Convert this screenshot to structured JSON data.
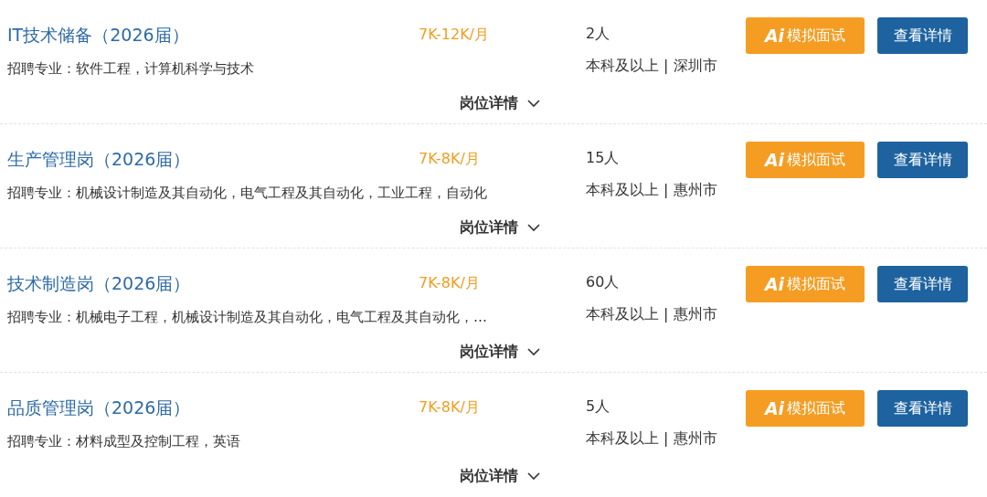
{
  "jobs": [
    {
      "title": "IT技术储备（2026届）",
      "salary": "7K-12K/月",
      "headcount": "2人",
      "majors": "招聘专业：软件工程，计算机科学与技术",
      "requirement": "本科及以上 | 深圳市",
      "ai_button": {
        "logo": "Ai",
        "label": "模拟面试"
      },
      "detail_button": "查看详情",
      "toggle": "岗位详情",
      "expanded": false
    },
    {
      "title": "生产管理岗（2026届）",
      "salary": "7K-8K/月",
      "headcount": "15人",
      "majors": "招聘专业：机械设计制造及其自动化，电气工程及其自动化，工业工程，自动化",
      "requirement": "本科及以上 | 惠州市",
      "ai_button": {
        "logo": "Ai",
        "label": "模拟面试"
      },
      "detail_button": "查看详情",
      "toggle": "岗位详情",
      "expanded": false
    },
    {
      "title": "技术制造岗（2026届）",
      "salary": "7K-8K/月",
      "headcount": "60人",
      "majors": "招聘专业：机械电子工程，机械设计制造及其自动化，电气工程及其自动化，…",
      "requirement": "本科及以上 | 惠州市",
      "ai_button": {
        "logo": "Ai",
        "label": "模拟面试"
      },
      "detail_button": "查看详情",
      "toggle": "岗位详情",
      "expanded": false
    },
    {
      "title": "品质管理岗（2026届）",
      "salary": "7K-8K/月",
      "headcount": "5人",
      "majors": "招聘专业：材料成型及控制工程，英语",
      "requirement": "本科及以上 | 惠州市",
      "ai_button": {
        "logo": "Ai",
        "label": "模拟面试"
      },
      "detail_button": "查看详情",
      "toggle": "岗位详情",
      "expanded": false
    }
  ]
}
